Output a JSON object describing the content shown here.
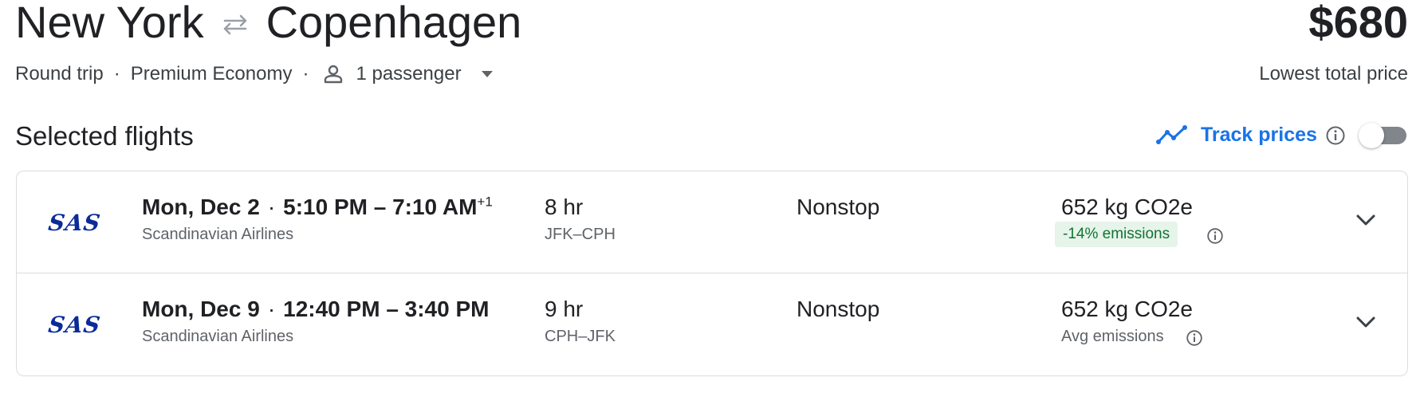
{
  "header": {
    "origin": "New York",
    "destination": "Copenhagen",
    "price": "$680",
    "price_caption": "Lowest total price"
  },
  "trip": {
    "type": "Round trip",
    "cabin": "Premium Economy",
    "separator": "·",
    "passengers": "1 passenger"
  },
  "section": {
    "title": "Selected flights",
    "track_label": "Track prices"
  },
  "flights": [
    {
      "logo": "SAS",
      "date": "Mon, Dec 2",
      "dot": "·",
      "times": "5:10 PM – 7:10 AM",
      "day_offset": "+1",
      "airline": "Scandinavian Airlines",
      "duration": "8 hr",
      "airports": "JFK–CPH",
      "stops": "Nonstop",
      "emissions": "652 kg CO2e",
      "emissions_note": "-14% emissions"
    },
    {
      "logo": "SAS",
      "date": "Mon, Dec 9",
      "dot": "·",
      "times": "12:40 PM – 3:40 PM",
      "airline": "Scandinavian Airlines",
      "duration": "9 hr",
      "airports": "CPH–JFK",
      "stops": "Nonstop",
      "emissions": "652 kg CO2e",
      "emissions_note": "Avg emissions"
    }
  ],
  "icons": {
    "swap": "swap-arrows-icon",
    "person": "person-icon",
    "caret": "caret-down-icon",
    "trend": "trend-line-icon",
    "info": "info-icon",
    "expand": "chevron-down-icon"
  },
  "colors": {
    "accent": "#1a73e8",
    "text": "#202124",
    "muted": "#5f6368",
    "border": "#dadce0",
    "sas_blue": "#0b2b99",
    "emissions_badge_bg": "#e6f4ea",
    "emissions_badge_text": "#137333"
  },
  "toggle": {
    "on": false
  }
}
